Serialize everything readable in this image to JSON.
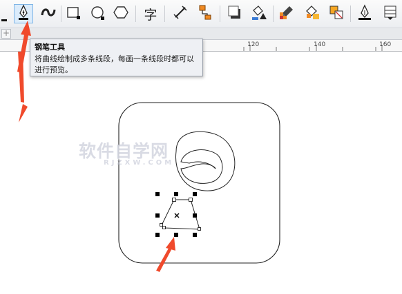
{
  "toolbar": {
    "tools": [
      {
        "name": "pen-tool-icon",
        "active": true
      },
      {
        "name": "artistic-media-icon"
      },
      {
        "name": "rectangle-tool-icon"
      },
      {
        "name": "ellipse-tool-icon"
      },
      {
        "name": "polygon-tool-icon"
      },
      {
        "name": "text-tool-icon",
        "glyph": "字"
      },
      {
        "name": "dimension-tool-icon"
      },
      {
        "name": "connector-tool-icon"
      },
      {
        "name": "drop-shadow-icon"
      },
      {
        "name": "fill-bucket-icon"
      },
      {
        "name": "color-eyedropper-icon"
      },
      {
        "name": "interactive-fill-icon"
      },
      {
        "name": "smart-fill-icon"
      },
      {
        "name": "outline-pen-icon"
      },
      {
        "name": "mesh-fill-icon"
      }
    ]
  },
  "tabstrip": {
    "add_label": "+"
  },
  "ruler": {
    "labels": [
      "120",
      "140",
      "160"
    ]
  },
  "tooltip": {
    "title": "钢笔工具",
    "body": "将曲线绘制成多条线段，每画一条线段时都可以进行预览。"
  },
  "watermark": {
    "main": "软件自学网",
    "sub": "RJZXW.COM"
  },
  "colors": {
    "accent_arrow": "#f04a2c",
    "active_tool_bg": "#dcecfb",
    "active_tool_border": "#7fb5e6"
  }
}
